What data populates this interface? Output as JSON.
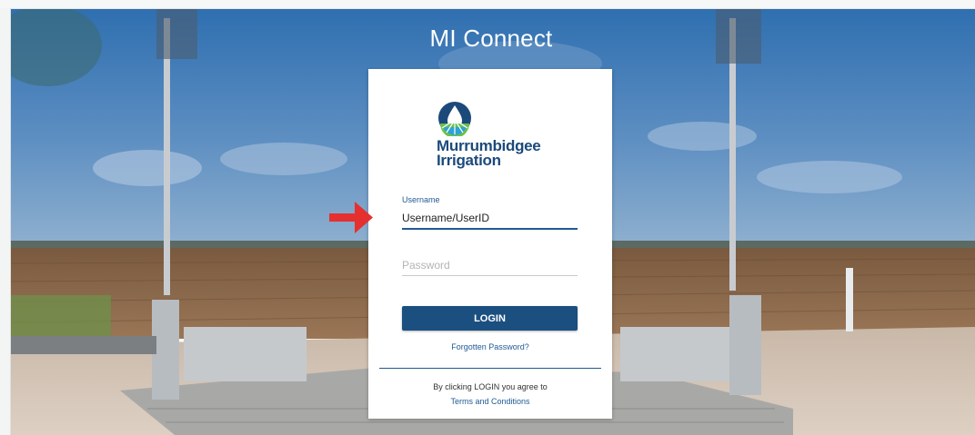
{
  "header": {
    "title": "MI Connect"
  },
  "brand": {
    "line1": "Murrumbidgee",
    "line2": "Irrigation",
    "color": "#1b4a7a"
  },
  "login_form": {
    "username_label": "Username",
    "username_value": "Username/UserID",
    "password_placeholder": "Password",
    "login_label": "LOGIN",
    "forgot_label": "Forgotten Password?",
    "agree_text": "By clicking LOGIN you agree to",
    "terms_label": "Terms and Conditions"
  },
  "colors": {
    "primary": "#1b4f80",
    "annotation_arrow": "#e53030"
  },
  "icons": {
    "logo": "droplet-sun-logo-icon",
    "annotation": "red-arrow-icon"
  }
}
